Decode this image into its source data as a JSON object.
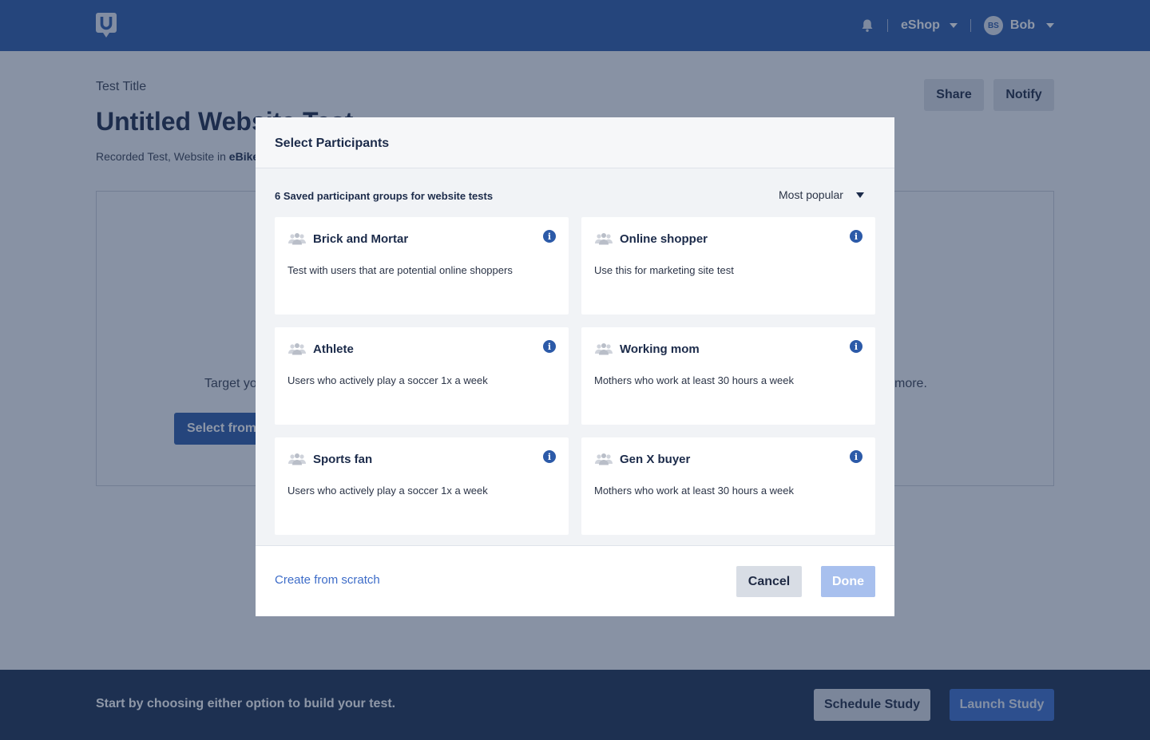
{
  "nav": {
    "brand_icon": "usertesting-logo-icon",
    "notification_icon": "bell-icon",
    "workspace": "eShop",
    "user_initials": "BS",
    "user_name": "Bob"
  },
  "page": {
    "test_label": "Test Title",
    "title": "Untitled Website Test",
    "subline_prefix": "Recorded Test, Website in",
    "subline_project": "eBike",
    "share_label": "Share",
    "notify_label": "Notify",
    "panel_text_left": "Target yo",
    "panel_text_right": "more.",
    "select_from_label": "Select from"
  },
  "bottom": {
    "message": "Start by choosing either option to build your test.",
    "schedule_label": "Schedule Study",
    "launch_label": "Launch Study"
  },
  "modal": {
    "title": "Select Participants",
    "groups_count": "6 Saved participant groups for website tests",
    "sort_value": "Most popular",
    "cards": [
      {
        "title": "Brick and Mortar",
        "desc": "Test with users that are potential online shoppers"
      },
      {
        "title": "Online shopper",
        "desc": "Use this for marketing site test"
      },
      {
        "title": "Athlete",
        "desc": "Users who actively play a soccer 1x a week"
      },
      {
        "title": "Working mom",
        "desc": "Mothers who work at least 30 hours a week"
      },
      {
        "title": "Sports fan",
        "desc": "Users who actively play a soccer 1x a week"
      },
      {
        "title": "Gen X buyer",
        "desc": "Mothers who work at least 30 hours a week"
      }
    ],
    "create_label": "Create from scratch",
    "cancel_label": "Cancel",
    "done_label": "Done"
  },
  "colors": {
    "primary": "#2c5aa8",
    "bottom_bar": "#1c3152",
    "done_disabled": "#a8c0ee"
  }
}
